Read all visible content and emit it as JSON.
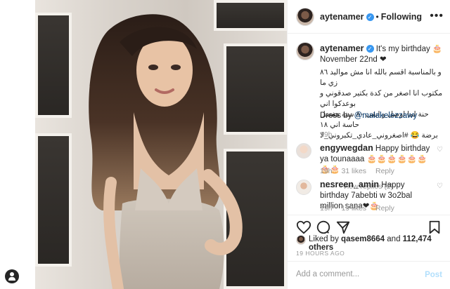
{
  "header": {
    "username": "aytenamer",
    "separator": "•",
    "follow_label": "Following",
    "more_label": "•••"
  },
  "caption": {
    "username": "aytenamer",
    "text_en": "It's my birthday 🎂 November 22nd ❤",
    "text_ar1": "و بالمناسبة اقسم بالله انا مش مواليد ٨٦ زي ما",
    "text_ar2": "مكتوب انا اصغر من كدة بكتير صدقوني و بوعدكوا اني",
    "text_ar3": "حنة لما اوصل و ابقى ٨٠ سنة هفضل حاسة اني ١٨",
    "text_ar4": "برضة 😂 #اصغروني_عادي_تكبروني_لا",
    "dress_label": "Dress by",
    "dress_handle": "@malakelezzawy",
    "time": "19h"
  },
  "comments": [
    {
      "username": "engywegdan",
      "text": "Happy birthday ya tounaaaa 🎂🎂🎂🎂🎂🎂🎂🎂",
      "time": "19h",
      "likes": "31 likes",
      "reply": "Reply",
      "view_replies": "View replies (2)"
    },
    {
      "username": "nesreen_amin",
      "text": "Happy birthday 7abebti w 3o2bal million sana❤🎂",
      "time": "19h",
      "likes": "19 likes",
      "reply": "Reply"
    }
  ],
  "actions": {
    "liked_by_prefix": "Liked by",
    "liked_by_user": "qasem8664",
    "and_label": "and",
    "others": "112,474 others",
    "timestamp": "19 HOURS AGO"
  },
  "add_comment": {
    "placeholder": "Add a comment...",
    "post_label": "Post"
  },
  "colors": {
    "verified": "#3897f0",
    "post_disabled": "#b2dffc",
    "muted": "#999999"
  }
}
